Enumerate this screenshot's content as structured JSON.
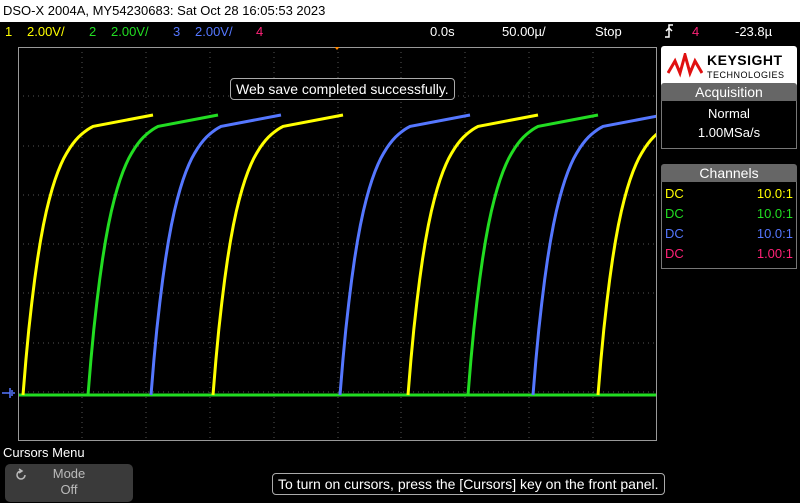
{
  "title_bar": "DSO-X 2004A, MY54230683: Sat Oct 28 16:05:53 2023",
  "status": {
    "channels": [
      {
        "num": "1",
        "scale": "2.00V/",
        "color": "#ffff00"
      },
      {
        "num": "2",
        "scale": "2.00V/",
        "color": "#22dd22"
      },
      {
        "num": "3",
        "scale": "2.00V/",
        "color": "#5577ff"
      },
      {
        "num": "4",
        "scale": "",
        "color": "#ff2277"
      }
    ],
    "time_delay": "0.0s",
    "timebase": "50.00µ/",
    "run_state": "Stop",
    "trigger_icon": "trigger-edge-icon",
    "trigger_channel": "4",
    "trigger_level": "-23.8µ"
  },
  "logo": {
    "brand": "KEYSIGHT",
    "sub": "TECHNOLOGIES"
  },
  "acquisition": {
    "header": "Acquisition",
    "mode": "Normal",
    "rate": "1.00MSa/s"
  },
  "channels_panel": {
    "header": "Channels",
    "rows": [
      {
        "coupling": "DC",
        "probe": "10.0:1",
        "color": "#ffff00"
      },
      {
        "coupling": "DC",
        "probe": "10.0:1",
        "color": "#22dd22"
      },
      {
        "coupling": "DC",
        "probe": "10.0:1",
        "color": "#5577ff"
      },
      {
        "coupling": "DC",
        "probe": "1.00:1",
        "color": "#ff2277"
      }
    ]
  },
  "message": "Web save completed successfully.",
  "menu": {
    "title": "Cursors Menu",
    "softkey_label": "Mode",
    "softkey_value": "Off",
    "softkey_icon": "rotate-knob-icon"
  },
  "hint": "To turn on cursors, press the [Cursors] key on the front panel."
}
